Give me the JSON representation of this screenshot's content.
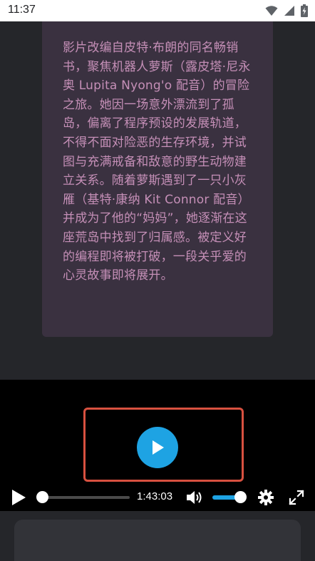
{
  "status_bar": {
    "time": "11:37",
    "icons": [
      "wifi-icon",
      "signal-icon",
      "battery-charging-icon"
    ]
  },
  "description": {
    "text": "影片改编自皮特·布朗的同名畅销书，聚焦机器人萝斯（露皮塔·尼永奥 Lupita Nyong'o 配音）的冒险之旅。她因一场意外漂流到了孤岛，偏离了程序预设的发展轨道，不得不面对险恶的生存环境，并试图与充满戒备和敌意的野生动物建立关系。随着萝斯遇到了一只小灰雁（基特·康纳 Kit Connor 配音）并成为了他的“妈妈”，她逐渐在这座荒岛中找到了归属感。被定义好的编程即将被打破，一段关乎爱的心灵故事即将展开。"
  },
  "player": {
    "current_time": "1:43:03",
    "progress": 0.0,
    "volume": 1.0,
    "accent_color": "#1ea3e3",
    "highlight_color": "#d85140",
    "icons": [
      "play-icon",
      "volume-icon",
      "gear-icon",
      "fullscreen-icon"
    ]
  }
}
